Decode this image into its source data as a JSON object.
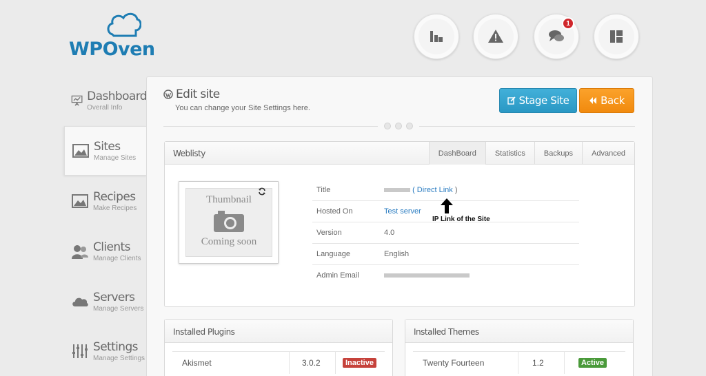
{
  "brand": {
    "name": "WPOven",
    "accent": "#1e7db3"
  },
  "top_icons": [
    {
      "name": "billing-icon"
    },
    {
      "name": "warning-icon"
    },
    {
      "name": "chat-icon",
      "badge": "1"
    },
    {
      "name": "layout-icon"
    }
  ],
  "sidebar": {
    "items": [
      {
        "title": "Dashboard",
        "sub": "Overall Info",
        "icon": "presentation-board-icon"
      },
      {
        "title": "Sites",
        "sub": "Manage Sites",
        "icon": "image-icon",
        "active": true
      },
      {
        "title": "Recipes",
        "sub": "Make Recipes",
        "icon": "image-icon"
      },
      {
        "title": "Clients",
        "sub": "Manage Clients",
        "icon": "users-icon"
      },
      {
        "title": "Servers",
        "sub": "Manage Servers",
        "icon": "cloud-icon"
      },
      {
        "title": "Settings",
        "sub": "Manage Settings",
        "icon": "sliders-icon"
      }
    ]
  },
  "header": {
    "title": "Edit site",
    "subtitle": "You can change your Site Settings here.",
    "stage_label": "Stage Site",
    "back_label": "Back",
    "stage_color": "#2a98c4",
    "back_color": "#f18a0e"
  },
  "site": {
    "name": "Weblisty",
    "tabs": [
      "DashBoard",
      "Statistics",
      "Backups",
      "Advanced"
    ],
    "thumbnail": {
      "line1": "Thumbnail",
      "line2": "Coming soon"
    },
    "info": [
      {
        "label": "Title",
        "value": "Direct Link"
      },
      {
        "label": "Hosted On",
        "value": "Test server"
      },
      {
        "label": "Version",
        "value": "4.0"
      },
      {
        "label": "Language",
        "value": "English"
      },
      {
        "label": "Admin Email",
        "value": ""
      }
    ],
    "annotation": "IP Link of the Site"
  },
  "plugins": {
    "title": "Installed Plugins",
    "rows": [
      {
        "name": "Akismet",
        "version": "3.0.2",
        "status": "Inactive",
        "status_color": "#c6423b"
      }
    ]
  },
  "themes": {
    "title": "Installed Themes",
    "rows": [
      {
        "name": "Twenty Fourteen",
        "version": "1.2",
        "status": "Active",
        "status_color": "#4a9a3a"
      }
    ]
  }
}
